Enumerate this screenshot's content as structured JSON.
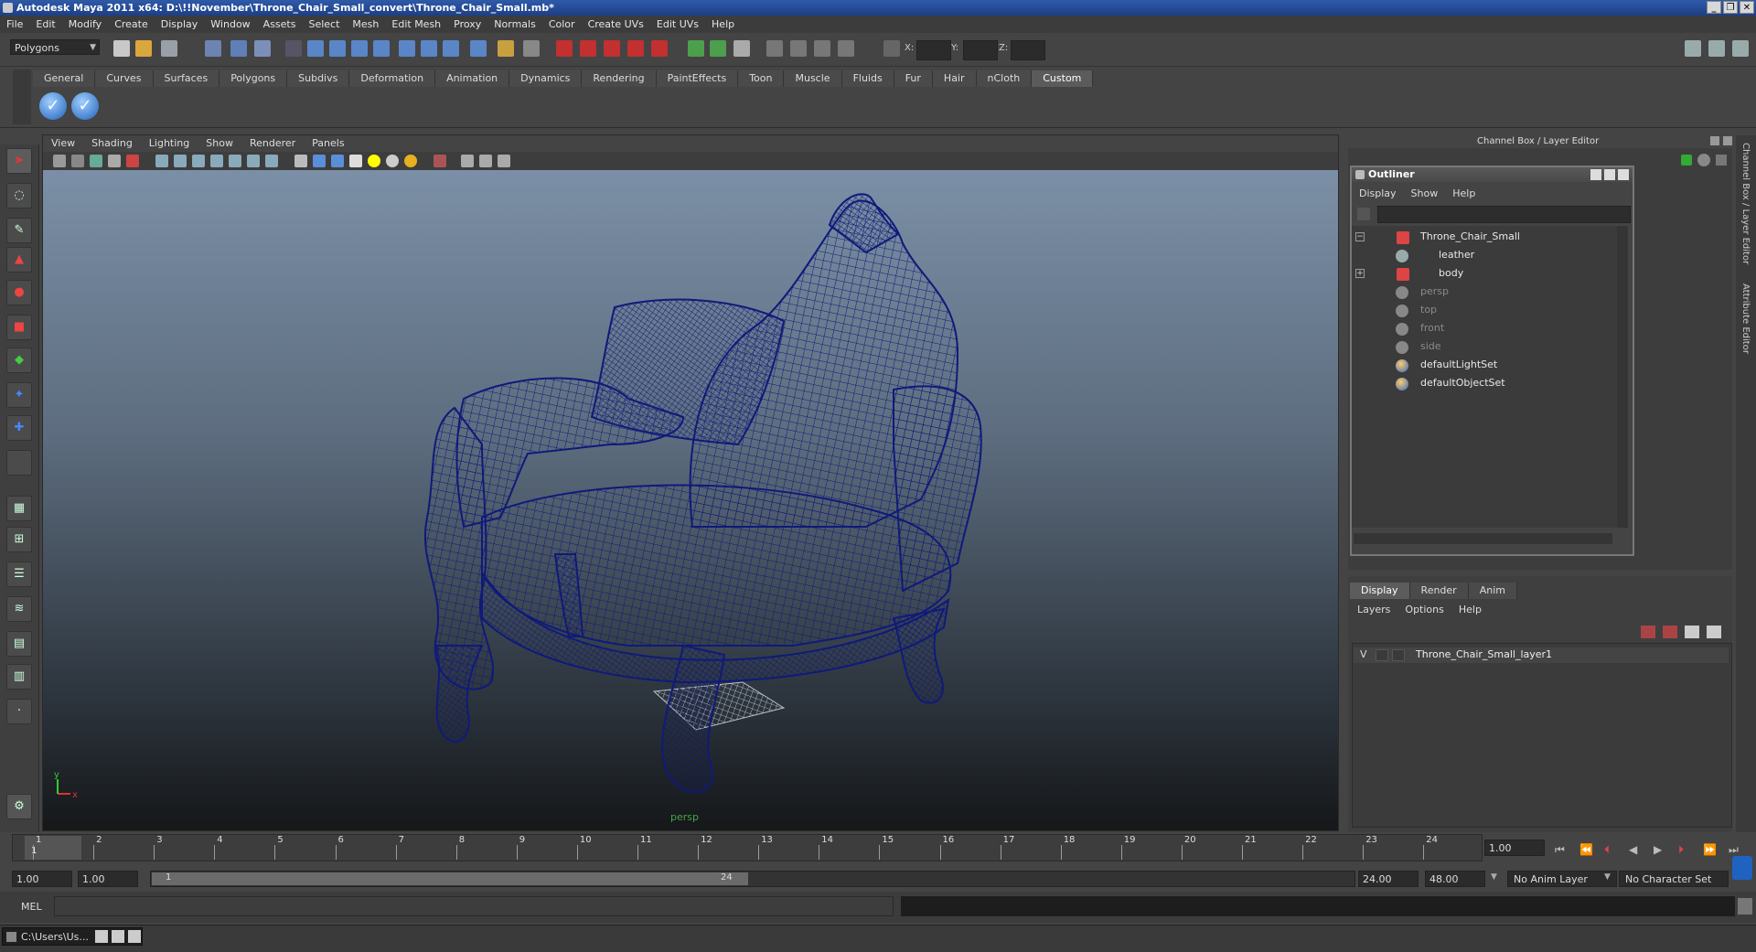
{
  "window": {
    "title": "Autodesk Maya 2011 x64: D:\\!!November\\Throne_Chair_Small_convert\\Throne_Chair_Small.mb*"
  },
  "menubar": [
    "File",
    "Edit",
    "Modify",
    "Create",
    "Display",
    "Window",
    "Assets",
    "Select",
    "Mesh",
    "Edit Mesh",
    "Proxy",
    "Normals",
    "Color",
    "Create UVs",
    "Edit UVs",
    "Help"
  ],
  "statusline": {
    "mode": "Polygons",
    "x_label": "X:",
    "y_label": "Y:",
    "z_label": "Z:"
  },
  "shelf": {
    "tabs": [
      "General",
      "Curves",
      "Surfaces",
      "Polygons",
      "Subdivs",
      "Deformation",
      "Animation",
      "Dynamics",
      "Rendering",
      "PaintEffects",
      "Toon",
      "Muscle",
      "Fluids",
      "Fur",
      "Hair",
      "nCloth",
      "Custom"
    ],
    "active_tab": "Custom"
  },
  "viewport": {
    "menu": [
      "View",
      "Shading",
      "Lighting",
      "Show",
      "Renderer",
      "Panels"
    ],
    "camera_label": "persp",
    "axis_y": "y",
    "axis_x": "x"
  },
  "right_panel": {
    "title": "Channel Box / Layer Editor",
    "side_tab_1": "Channel Box / Layer Editor",
    "side_tab_2": "Attribute Editor"
  },
  "outliner": {
    "title": "Outliner",
    "menu": [
      "Display",
      "Show",
      "Help"
    ],
    "items": [
      {
        "label": "Throne_Chair_Small",
        "dim": false
      },
      {
        "label": "leather",
        "dim": false
      },
      {
        "label": "body",
        "dim": false
      },
      {
        "label": "persp",
        "dim": true
      },
      {
        "label": "top",
        "dim": true
      },
      {
        "label": "front",
        "dim": true
      },
      {
        "label": "side",
        "dim": true
      },
      {
        "label": "defaultLightSet",
        "dim": false
      },
      {
        "label": "defaultObjectSet",
        "dim": false
      }
    ]
  },
  "layer_editor": {
    "tabs": [
      "Display",
      "Render",
      "Anim"
    ],
    "active_tab": "Display",
    "menu": [
      "Layers",
      "Options",
      "Help"
    ],
    "layers": [
      {
        "visible": "V",
        "name": "Throne_Chair_Small_layer1"
      }
    ]
  },
  "timeline": {
    "ticks": [
      "1",
      "2",
      "3",
      "4",
      "5",
      "6",
      "7",
      "8",
      "9",
      "10",
      "11",
      "12",
      "13",
      "14",
      "15",
      "16",
      "17",
      "18",
      "19",
      "20",
      "21",
      "22",
      "23",
      "24"
    ],
    "current_frame_marker": "1",
    "current_frame": "1.00"
  },
  "range": {
    "start": "1.00",
    "playback_start": "1.00",
    "bar_start_label": "1",
    "bar_end_label": "24",
    "playback_end": "24.00",
    "end": "48.00",
    "anim_layer": "No Anim Layer",
    "character_set": "No Character Set"
  },
  "command_line": {
    "label": "MEL"
  },
  "taskbar": {
    "item": "C:\\Users\\Us..."
  },
  "colors": {
    "wire": "#0f1a7a",
    "accent": "#2f5aa8"
  }
}
